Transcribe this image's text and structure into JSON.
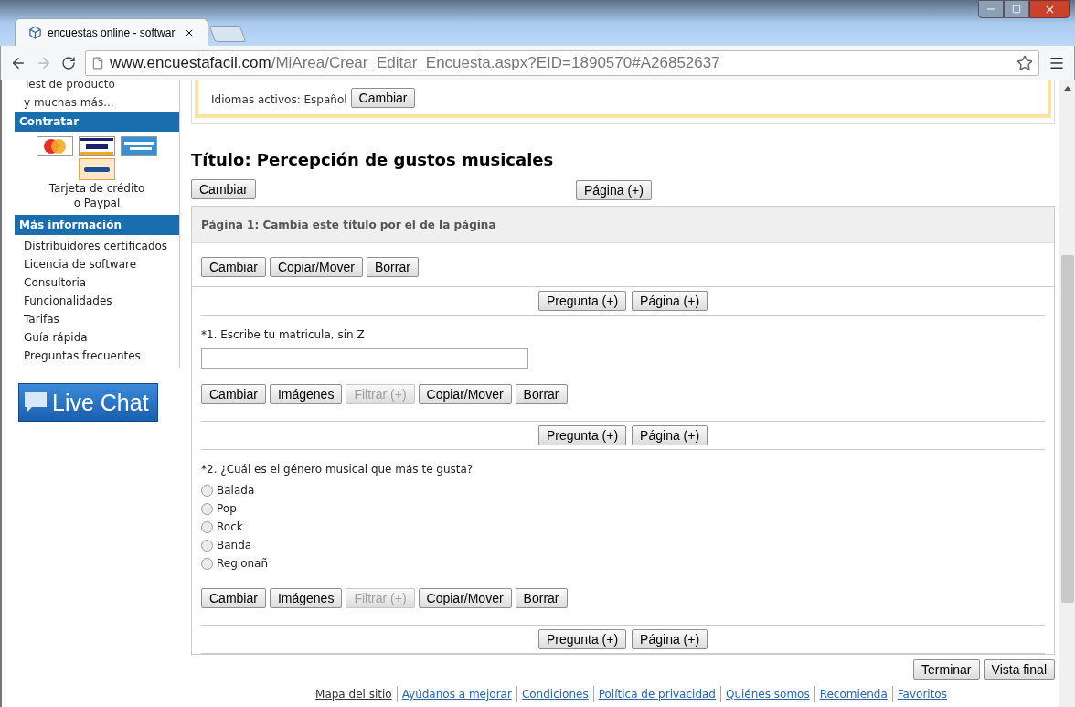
{
  "browser": {
    "tab_title": "encuestas online - softwar",
    "url_host": "www.encuestafacil.com",
    "url_path": "/MiArea/Crear_Editar_Encuesta.aspx?EID=1890570#A26852637"
  },
  "sidebar": {
    "top_items": [
      "Test de producto",
      "y muchas más..."
    ],
    "contratar": {
      "heading": "Contratar",
      "caption_lines": [
        "Tarjeta de crédito",
        "o Paypal"
      ]
    },
    "info": {
      "heading": "Más información",
      "links": [
        "Distribuidores certificados",
        "Licencia de software",
        "Consultoria",
        "Funcionalidades",
        "Tarifas",
        "Guía rápida",
        "Preguntas frecuentes"
      ]
    },
    "live_chat": "Live Chat"
  },
  "languages": {
    "label": "Idiomas activos: Español",
    "button": "Cambiar"
  },
  "survey": {
    "title": "Título: Percepción de gustos musicales",
    "change_button": "Cambiar",
    "add_page_button": "Página (+)"
  },
  "page": {
    "header": "Página 1: Cambia este título por el de la página",
    "buttons": [
      {
        "label": "Cambiar",
        "disabled": false
      },
      {
        "label": "Copiar/Mover",
        "disabled": false
      },
      {
        "label": "Borrar",
        "disabled": false
      }
    ],
    "insert_buttons": [
      "Pregunta (+)",
      "Página (+)"
    ],
    "questions": [
      {
        "kind": "text",
        "text": "*1. Escribe tu matricula, sin Z",
        "buttons": [
          {
            "label": "Cambiar",
            "disabled": false
          },
          {
            "label": "Imágenes",
            "disabled": false
          },
          {
            "label": "Filtrar (+)",
            "disabled": true
          },
          {
            "label": "Copiar/Mover",
            "disabled": false
          },
          {
            "label": "Borrar",
            "disabled": false
          }
        ],
        "insert_buttons": [
          "Pregunta (+)",
          "Página (+)"
        ]
      },
      {
        "kind": "radio",
        "text": "*2. ¿Cuál es el género musical que más te gusta?",
        "options": [
          {
            "label": "Balada",
            "selected": false
          },
          {
            "label": "Pop",
            "selected": false
          },
          {
            "label": "Rock",
            "selected": false
          },
          {
            "label": "Banda",
            "selected": false
          },
          {
            "label": "Regionañ",
            "selected": false
          }
        ],
        "buttons": [
          {
            "label": "Cambiar",
            "disabled": false
          },
          {
            "label": "Imágenes",
            "disabled": false
          },
          {
            "label": "Filtrar (+)",
            "disabled": true
          },
          {
            "label": "Copiar/Mover",
            "disabled": false
          },
          {
            "label": "Borrar",
            "disabled": false
          }
        ],
        "insert_buttons": [
          "Pregunta (+)",
          "Página (+)"
        ]
      }
    ]
  },
  "final_buttons": [
    "Terminar",
    "Vista final"
  ],
  "footer_links": [
    "Mapa del sitio",
    "Ayúdanos a mejorar",
    "Condiciones",
    "Política de privacidad",
    "Quiénes somos",
    "Recomienda",
    "Favoritos"
  ]
}
